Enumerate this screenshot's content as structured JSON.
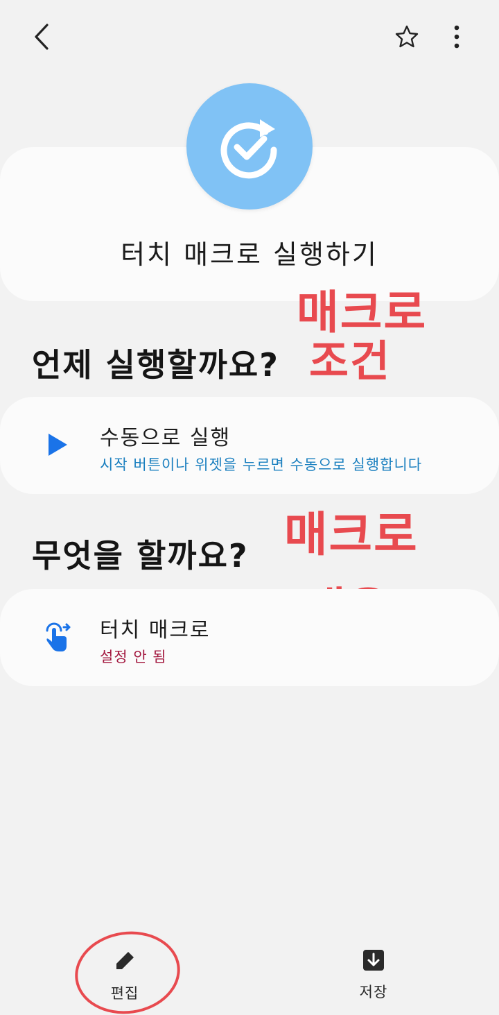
{
  "header": {
    "back_icon": "chevron-left-icon",
    "favorite_icon": "star-outline-icon",
    "more_icon": "more-vertical-icon"
  },
  "macro": {
    "title": "터치 매크로 실행하기",
    "icon": "refresh-check-icon",
    "icon_color": "#80c2f5"
  },
  "when_section": {
    "title": "언제 실행할까요?",
    "trigger": {
      "title": "수동으로 실행",
      "description": "시작 버튼이나 위젯을 누르면 수동으로 실행합니다",
      "description_color": "#1a7fbf",
      "icon": "play-icon",
      "icon_color": "#1a73e8"
    }
  },
  "what_section": {
    "title": "무엇을 할까요?",
    "action": {
      "title": "터치 매크로",
      "status": "설정 안 됨",
      "status_color": "#a3183f",
      "icon": "touch-gesture-icon",
      "icon_color": "#1a73e8"
    }
  },
  "annotations": {
    "condition_line1": "매크로",
    "condition_line2": "조건",
    "content_line1": "매크로",
    "content_line2": "내용",
    "color": "#e84a4f"
  },
  "bottom_bar": {
    "edit_label": "편집",
    "save_label": "저장"
  }
}
